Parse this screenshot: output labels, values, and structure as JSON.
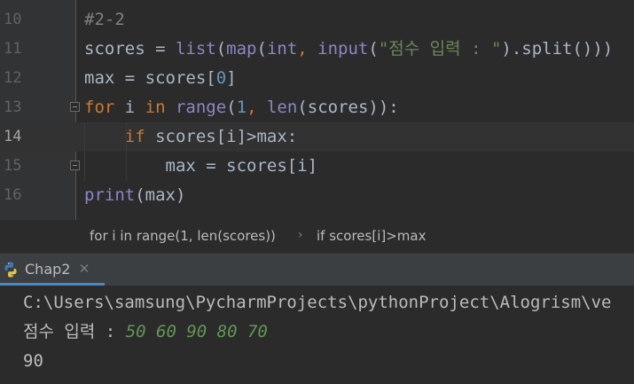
{
  "editor": {
    "lines": [
      {
        "number": "10",
        "segments": [
          {
            "cls": "t-comment",
            "text": "#2-2"
          }
        ]
      },
      {
        "number": "11",
        "segments": [
          {
            "cls": "t-plain",
            "text": "scores = "
          },
          {
            "cls": "t-builtin",
            "text": "list"
          },
          {
            "cls": "t-plain",
            "text": "("
          },
          {
            "cls": "t-builtin",
            "text": "map"
          },
          {
            "cls": "t-plain",
            "text": "("
          },
          {
            "cls": "t-builtin",
            "text": "int"
          },
          {
            "cls": "t-kw",
            "text": ", "
          },
          {
            "cls": "t-builtin",
            "text": "input"
          },
          {
            "cls": "t-plain",
            "text": "("
          },
          {
            "cls": "t-str",
            "text": "\"점수 입력 : \""
          },
          {
            "cls": "t-plain",
            "text": ").split()))"
          }
        ]
      },
      {
        "number": "12",
        "segments": [
          {
            "cls": "t-plain",
            "text": "max = scores["
          },
          {
            "cls": "t-num",
            "text": "0"
          },
          {
            "cls": "t-plain",
            "text": "]"
          }
        ]
      },
      {
        "number": "13",
        "segments": [
          {
            "cls": "t-kw",
            "text": "for "
          },
          {
            "cls": "t-plain",
            "text": "i "
          },
          {
            "cls": "t-kw",
            "text": "in "
          },
          {
            "cls": "t-builtin",
            "text": "range"
          },
          {
            "cls": "t-plain",
            "text": "("
          },
          {
            "cls": "t-num",
            "text": "1"
          },
          {
            "cls": "t-kw",
            "text": ", "
          },
          {
            "cls": "t-builtin",
            "text": "len"
          },
          {
            "cls": "t-plain",
            "text": "(scores)):"
          }
        ]
      },
      {
        "number": "14",
        "segments": [
          {
            "cls": "t-plain",
            "text": "    "
          },
          {
            "cls": "t-kw",
            "text": "if "
          },
          {
            "cls": "t-plain",
            "text": "scores[i]>max:"
          }
        ]
      },
      {
        "number": "15",
        "segments": [
          {
            "cls": "t-plain",
            "text": "        max = scores[i]"
          }
        ]
      },
      {
        "number": "16",
        "segments": [
          {
            "cls": "t-builtin",
            "text": "print"
          },
          {
            "cls": "t-plain",
            "text": "(max)"
          }
        ]
      }
    ]
  },
  "breadcrumb": {
    "items": [
      "for i in range(1, len(scores))",
      "if scores[i]>max"
    ],
    "separator": "›"
  },
  "run_panel": {
    "tab_label": "Chap2",
    "close_glyph": "✕",
    "tab_icon": "python-icon"
  },
  "console": {
    "command": "C:\\Users\\samsung\\PycharmProjects\\pythonProject\\Alogrism\\ve",
    "prompt": "점수 입력 : ",
    "user_input": "50 60 90 80 70",
    "output": "90"
  },
  "colors": {
    "editor_bg": "#2b2b2b",
    "keyword": "#cc7832",
    "builtin": "#8888c6",
    "number": "#6897bb",
    "string": "#6a8759",
    "console_input": "#629755",
    "accent": "#4a88c7"
  }
}
